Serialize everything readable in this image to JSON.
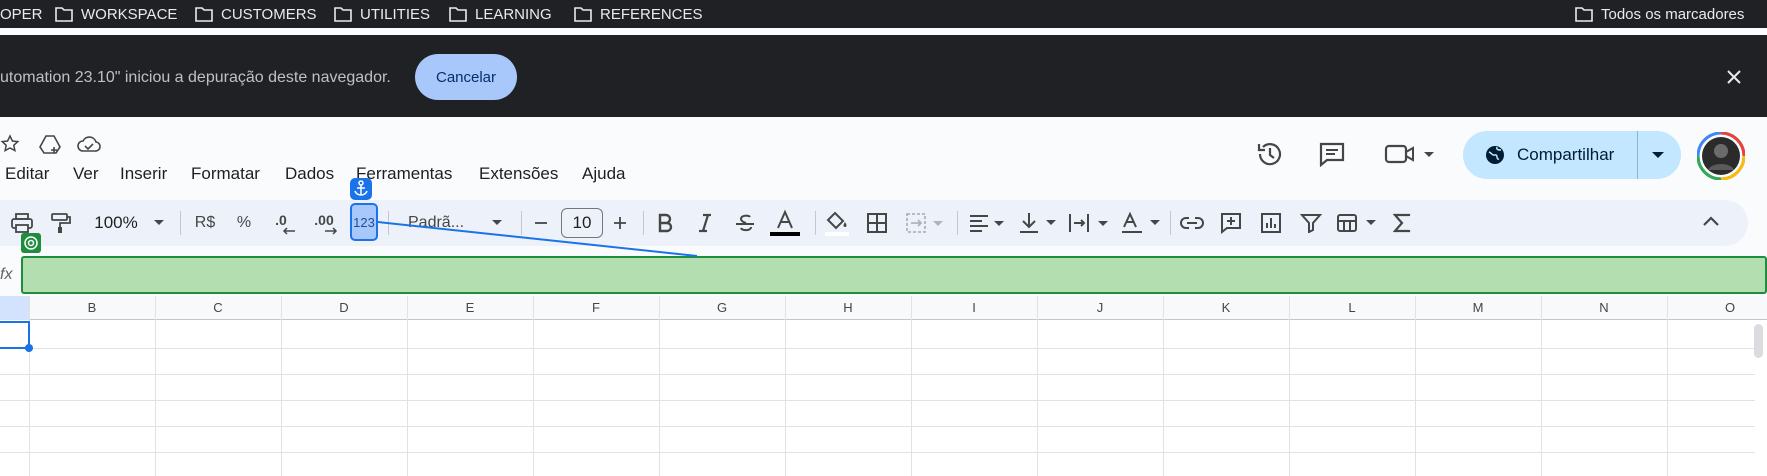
{
  "bookmarks": {
    "items": [
      {
        "label": "OPER"
      },
      {
        "label": "WORKSPACE"
      },
      {
        "label": "CUSTOMERS"
      },
      {
        "label": "UTILITIES"
      },
      {
        "label": "LEARNING"
      },
      {
        "label": "REFERENCES"
      }
    ],
    "all_bookmarks": "Todos os marcadores"
  },
  "infobar": {
    "message": "utomation 23.10\" iniciou a depuração deste navegador.",
    "cancel_label": "Cancelar"
  },
  "menu": {
    "items": [
      "Editar",
      "Ver",
      "Inserir",
      "Formatar",
      "Dados",
      "Ferramentas",
      "Extensões",
      "Ajuda"
    ]
  },
  "header": {
    "share_label": "Compartilhar"
  },
  "toolbar": {
    "zoom": "100%",
    "currency": "R$",
    "percent": "%",
    "decrease_decimal": ".0",
    "increase_decimal": ".00",
    "more_formats": "123",
    "font": "Padrã...",
    "font_size": "10"
  },
  "formula_bar": {
    "fx": "fx"
  },
  "sheet": {
    "columns": [
      "B",
      "C",
      "D",
      "E",
      "F",
      "G",
      "H",
      "I",
      "J",
      "K",
      "L",
      "M",
      "N",
      "O"
    ]
  },
  "colors": {
    "accent": "#1a73e8",
    "share_bg": "#c2e7ff",
    "highlight_green": "#b3dfb0"
  }
}
